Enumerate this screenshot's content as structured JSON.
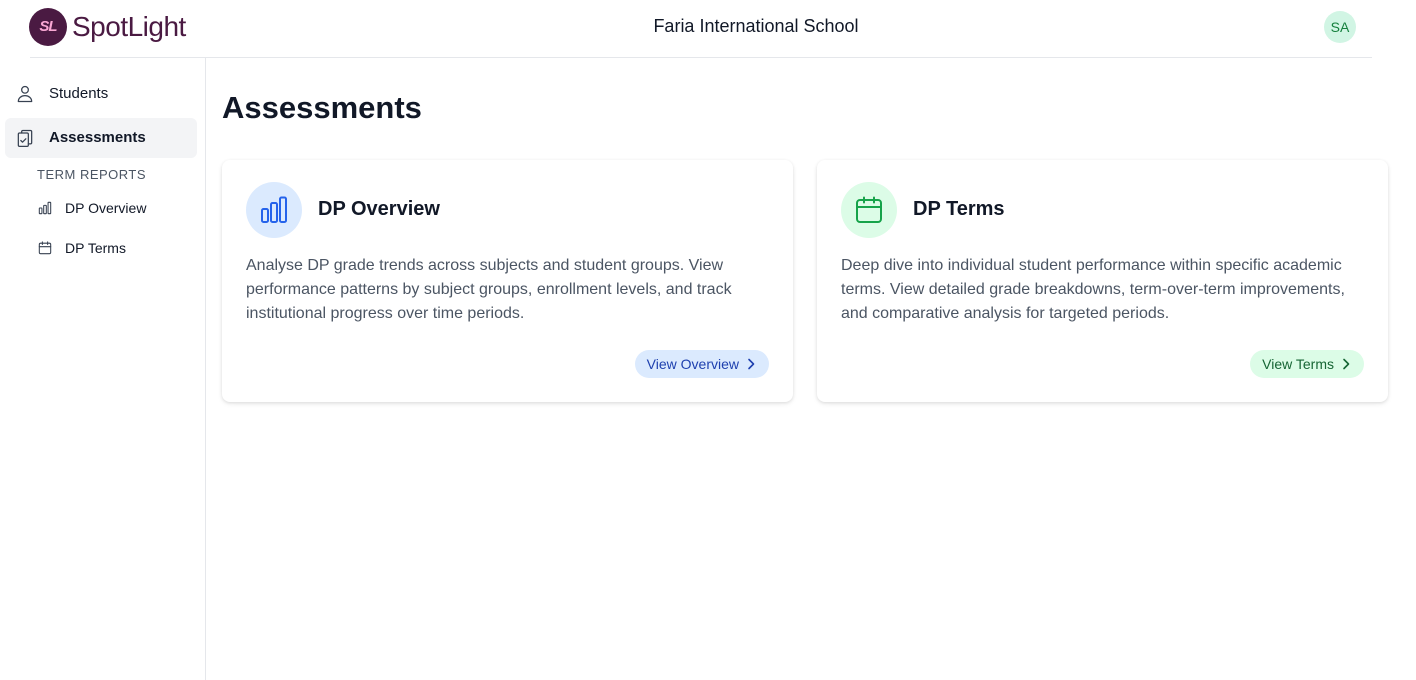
{
  "app": {
    "logo_badge": "SL",
    "logo_text": "SpotLight",
    "brand_color": "#4a1a42"
  },
  "header": {
    "school_name": "Faria International School",
    "avatar_initials": "SA"
  },
  "sidebar": {
    "items": [
      {
        "label": "Students",
        "icon": "user-icon",
        "active": false
      },
      {
        "label": "Assessments",
        "icon": "clipboard-check-icon",
        "active": true
      }
    ],
    "section_label": "TERM REPORTS",
    "sub_items": [
      {
        "label": "DP Overview",
        "icon": "bar-chart-icon"
      },
      {
        "label": "DP Terms",
        "icon": "calendar-icon"
      }
    ]
  },
  "main": {
    "title": "Assessments",
    "cards": [
      {
        "title": "DP Overview",
        "icon": "bar-chart-icon",
        "description": "Analyse DP grade trends across subjects and student groups. View performance patterns by subject groups, enrollment levels, and track institutional progress over time periods.",
        "button_label": "View Overview",
        "accent": "#2563eb",
        "accent_bg": "#dbeafe",
        "button_text_color": "#1e40af"
      },
      {
        "title": "DP Terms",
        "icon": "calendar-icon",
        "description": "Deep dive into individual student performance within specific academic terms. View detailed grade breakdowns, term-over-term improvements, and comparative analysis for targeted periods.",
        "button_label": "View Terms",
        "accent": "#16a34a",
        "accent_bg": "#dcfce7",
        "button_text_color": "#166534"
      }
    ]
  }
}
